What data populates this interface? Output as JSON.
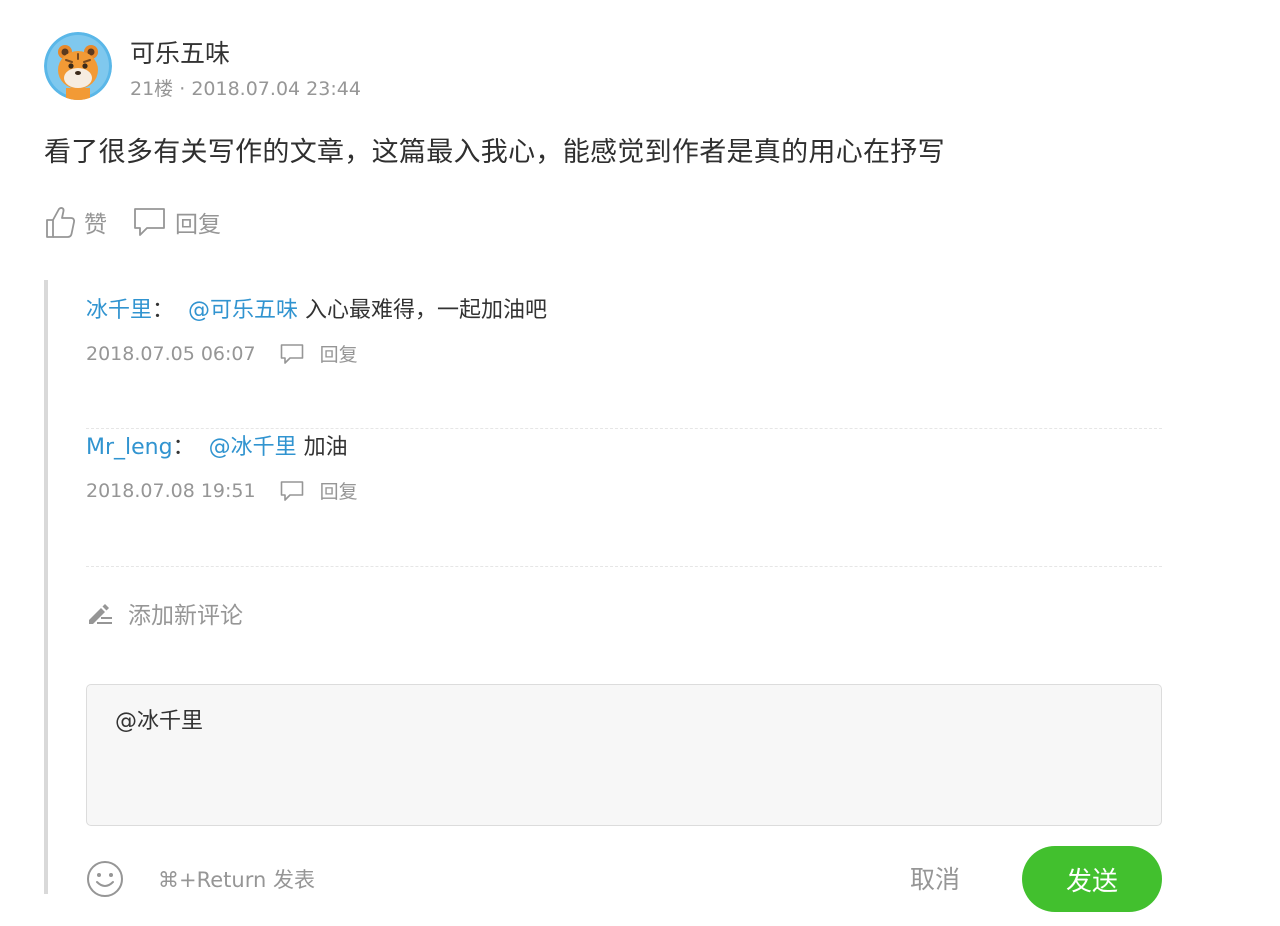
{
  "comment": {
    "author": "可乐五味",
    "floor": "21楼",
    "meta_separator": "·",
    "time": "2018.07.04 23:44",
    "text": "看了很多有关写作的文章，这篇最入我心，能感觉到作者是真的用心在抒写",
    "like_label": "赞",
    "reply_label": "回复"
  },
  "subcomments": [
    {
      "author": "冰千里",
      "colon": "：",
      "mention": "@可乐五味",
      "text": "入心最难得，一起加油吧",
      "time": "2018.07.05 06:07",
      "reply_label": "回复"
    },
    {
      "author": "Mr_leng",
      "colon": "：",
      "mention": "@冰千里",
      "text": "加油",
      "time": "2018.07.08 19:51",
      "reply_label": "回复"
    }
  ],
  "add_new_label": "添加新评论",
  "editor": {
    "value": "@冰千里",
    "hint": "⌘+Return 发表",
    "cancel_label": "取消",
    "send_label": "发送"
  },
  "colors": {
    "link": "#3194d0",
    "send_button": "#42c02e",
    "muted": "#969696"
  },
  "icons": [
    "avatar",
    "thumbs-up-icon",
    "comment-icon",
    "pencil-icon",
    "emoji-icon"
  ]
}
